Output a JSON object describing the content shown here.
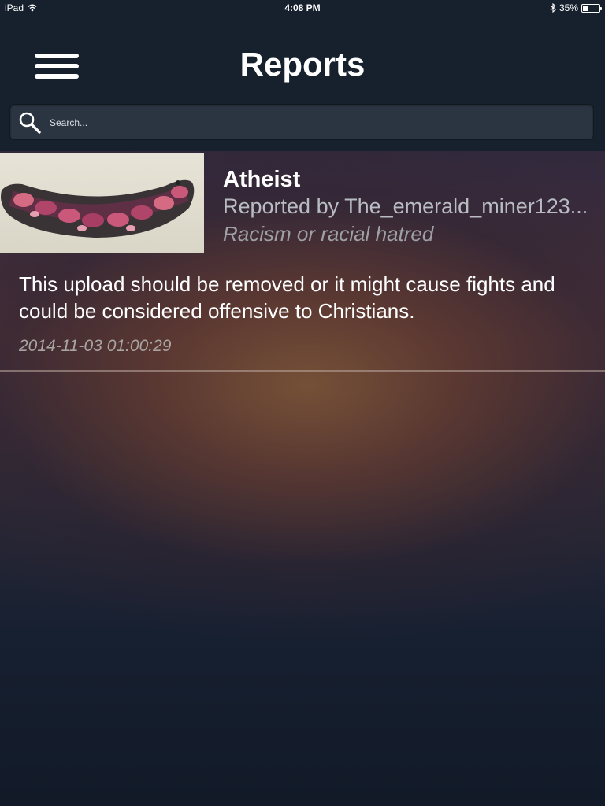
{
  "status_bar": {
    "device": "iPad",
    "time": "4:08 PM",
    "battery": "35%",
    "battery_level": 0.35
  },
  "header": {
    "title": "Reports",
    "menu_icon": "hamburger-menu-icon"
  },
  "search": {
    "placeholder": "Search...",
    "value": "",
    "icon": "search-icon"
  },
  "reports": [
    {
      "title": "Atheist",
      "reported_by": "Reported by The_emerald_miner123...",
      "reason": "Racism or racial hatred",
      "description": "This upload should be removed or it might cause fights and could be considered offensive to Christians.",
      "timestamp": "2014-11-03 01:00:29"
    }
  ],
  "colors": {
    "header_bg": "#17212e",
    "search_bg": "#2b3542",
    "text_primary": "#ffffff",
    "text_secondary": "#b9bcc2",
    "text_muted": "#9ea0a6"
  }
}
